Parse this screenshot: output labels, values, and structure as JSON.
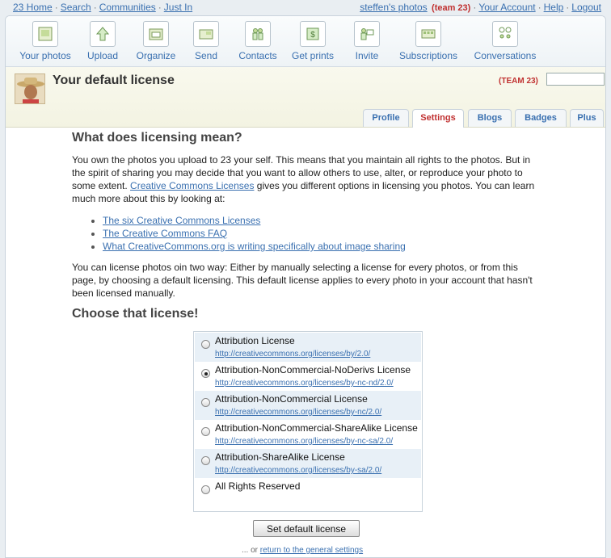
{
  "topbar": {
    "home": "23 Home",
    "search": "Search",
    "communities": "Communities",
    "just_in": "Just In",
    "user_photos": "steffen's photos",
    "team": "(team 23)",
    "account": "Your Account",
    "help": "Help",
    "logout": "Logout"
  },
  "nav": [
    {
      "label": "Your photos",
      "icon": "photo-icon"
    },
    {
      "label": "Upload",
      "icon": "upload-arrow-icon"
    },
    {
      "label": "Organize",
      "icon": "folder-icon"
    },
    {
      "label": "Send",
      "icon": "send-envelope-icon"
    },
    {
      "label": "Contacts",
      "icon": "people-icon"
    },
    {
      "label": "Get prints",
      "icon": "prints-icon"
    },
    {
      "label": "Invite",
      "icon": "invite-icon"
    },
    {
      "label": "Subscriptions",
      "icon": "grid-icon"
    },
    {
      "label": "Conversations",
      "icon": "speech-bubbles-icon"
    }
  ],
  "header": {
    "title": "Your default license",
    "team_tag": "(TEAM 23)",
    "tabs": [
      "Profile",
      "Settings",
      "Blogs",
      "Badges",
      "Plus"
    ],
    "active_tab": "Settings"
  },
  "main": {
    "heading1": "What does licensing mean?",
    "p1_a": "You own the photos you upload to 23 your self. This means that you maintain all rights to the photos. But in the spirit of sharing you may decide that you want to allow others to use, alter, or reproduce your photo to some extent. ",
    "p1_link": "Creative Commons Licenses",
    "p1_b": " gives you different options in licensing you photos. You can learn much more about this by looking at:",
    "links": [
      "The six Creative Commons Licenses",
      "The Creative Commons FAQ",
      "What CreativeCommons.org is writing specifically about image sharing"
    ],
    "p2": "You can license photos oin two way: Either by manually selecting a license for every photos, or from this page, by choosing a default licensing. This default license applies to every photo in your account that hasn't been licensed manually.",
    "heading2": "Choose that license!",
    "licenses": [
      {
        "name": "Attribution License",
        "url": "http://creativecommons.org/licenses/by/2.0/",
        "selected": false
      },
      {
        "name": "Attribution-NonCommercial-NoDerivs License",
        "url": "http://creativecommons.org/licenses/by-nc-nd/2.0/",
        "selected": true
      },
      {
        "name": "Attribution-NonCommercial License",
        "url": "http://creativecommons.org/licenses/by-nc/2.0/",
        "selected": false
      },
      {
        "name": "Attribution-NonCommercial-ShareAlike License",
        "url": "http://creativecommons.org/licenses/by-nc-sa/2.0/",
        "selected": false
      },
      {
        "name": "Attribution-ShareAlike License",
        "url": "http://creativecommons.org/licenses/by-sa/2.0/",
        "selected": false
      },
      {
        "name": "All Rights Reserved",
        "url": "",
        "selected": false
      }
    ],
    "button_label": "Set default license",
    "footer_prefix": "... or ",
    "footer_link": "return to the general settings"
  }
}
